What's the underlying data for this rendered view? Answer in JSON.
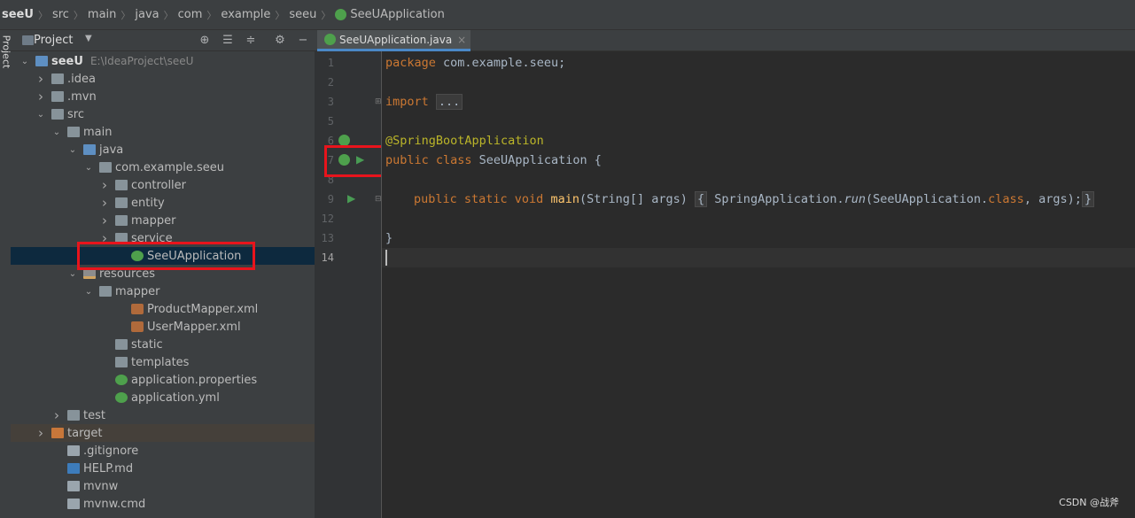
{
  "breadcrumbs": [
    "seeU",
    "src",
    "main",
    "java",
    "com",
    "example",
    "seeu",
    "SeeUApplication"
  ],
  "side_strip_label": "Project",
  "project_panel": {
    "title": "Project",
    "tree": [
      {
        "label": "seeU",
        "sub": "E:\\IdeaProject\\seeU",
        "depth": 0,
        "arrow": "down",
        "icon": "module-folder",
        "bold": true
      },
      {
        "label": ".idea",
        "depth": 1,
        "arrow": "right",
        "icon": "folder"
      },
      {
        "label": ".mvn",
        "depth": 1,
        "arrow": "right",
        "icon": "folder"
      },
      {
        "label": "src",
        "depth": 1,
        "arrow": "down",
        "icon": "folder"
      },
      {
        "label": "main",
        "depth": 2,
        "arrow": "down",
        "icon": "folder"
      },
      {
        "label": "java",
        "depth": 3,
        "arrow": "down",
        "icon": "source-folder"
      },
      {
        "label": "com.example.seeu",
        "depth": 4,
        "arrow": "down",
        "icon": "package-folder"
      },
      {
        "label": "controller",
        "depth": 5,
        "arrow": "right",
        "icon": "package-folder"
      },
      {
        "label": "entity",
        "depth": 5,
        "arrow": "right",
        "icon": "package-folder"
      },
      {
        "label": "mapper",
        "depth": 5,
        "arrow": "right",
        "icon": "package-folder"
      },
      {
        "label": "service",
        "depth": 5,
        "arrow": "right",
        "icon": "package-folder"
      },
      {
        "label": "SeeUApplication",
        "depth": 6,
        "arrow": "",
        "icon": "spring-boot-class",
        "selected": true
      },
      {
        "label": "resources",
        "depth": 3,
        "arrow": "down",
        "icon": "resources-folder"
      },
      {
        "label": "mapper",
        "depth": 4,
        "arrow": "down",
        "icon": "folder"
      },
      {
        "label": "ProductMapper.xml",
        "depth": 6,
        "arrow": "",
        "icon": "xml-file"
      },
      {
        "label": "UserMapper.xml",
        "depth": 6,
        "arrow": "",
        "icon": "xml-file"
      },
      {
        "label": "static",
        "depth": 5,
        "arrow": "",
        "icon": "folder"
      },
      {
        "label": "templates",
        "depth": 5,
        "arrow": "",
        "icon": "folder"
      },
      {
        "label": "application.properties",
        "depth": 5,
        "arrow": "",
        "icon": "spring-config-file"
      },
      {
        "label": "application.yml",
        "depth": 5,
        "arrow": "",
        "icon": "spring-config-file"
      },
      {
        "label": "test",
        "depth": 2,
        "arrow": "right",
        "icon": "folder"
      },
      {
        "label": "target",
        "depth": 1,
        "arrow": "right",
        "icon": "excluded-folder",
        "highlight": true
      },
      {
        "label": ".gitignore",
        "depth": 2,
        "arrow": "",
        "icon": "text-file"
      },
      {
        "label": "HELP.md",
        "depth": 2,
        "arrow": "",
        "icon": "markdown-file"
      },
      {
        "label": "mvnw",
        "depth": 2,
        "arrow": "",
        "icon": "text-file"
      },
      {
        "label": "mvnw.cmd",
        "depth": 2,
        "arrow": "",
        "icon": "text-file"
      }
    ]
  },
  "editor": {
    "tab_label": "SeeUApplication.java",
    "tab_close": "×",
    "line_numbers": [
      "1",
      "2",
      "3",
      "5",
      "6",
      "7",
      "8",
      "9",
      "12",
      "13",
      "14"
    ],
    "code": {
      "l1_kw": "package",
      "l1_rest": " com.example.seeu;",
      "l3_kw": "import",
      "l3_fold": "...",
      "l6_ann": "@SpringBootApplication",
      "l7_kw": "public class",
      "l7_rest": " SeeUApplication {",
      "l9_kw": "public static void",
      "l9_fn": "main",
      "l9_args": "(String[] args)",
      "l9_open": "{",
      "l9_call1": " SpringApplication.",
      "l9_run": "run",
      "l9_call2": "(SeeUApplication.",
      "l9_class_kw": "class",
      "l9_call3": ", args);",
      "l9_close": "}",
      "l13": "}"
    }
  },
  "watermark": "CSDN @战斧"
}
